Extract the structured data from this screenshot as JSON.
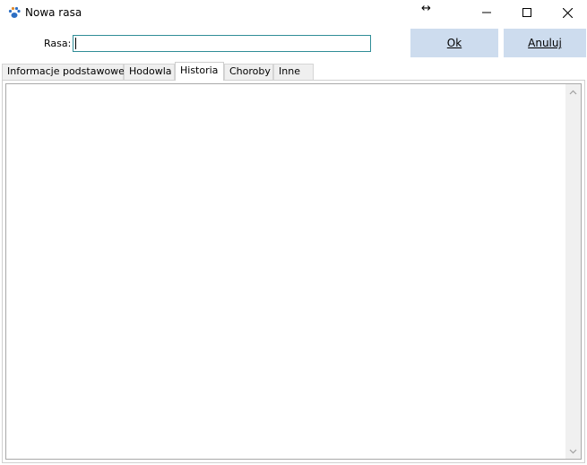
{
  "window": {
    "title": "Nowa rasa",
    "app_icon": "paw-icon",
    "controls": [
      "minimize-icon",
      "maximize-icon",
      "close-icon"
    ]
  },
  "form": {
    "rasa_label": "Rasa:",
    "rasa_value": ""
  },
  "buttons": {
    "ok_label": "Ok",
    "cancel_label": "Anuluj"
  },
  "tabs": [
    {
      "label": "Informacje podstawowe",
      "active": false
    },
    {
      "label": "Hodowla",
      "active": false
    },
    {
      "label": "Historia",
      "active": true
    },
    {
      "label": "Choroby",
      "active": false
    },
    {
      "label": "Inne",
      "active": false
    }
  ],
  "historia": {
    "text": ""
  }
}
